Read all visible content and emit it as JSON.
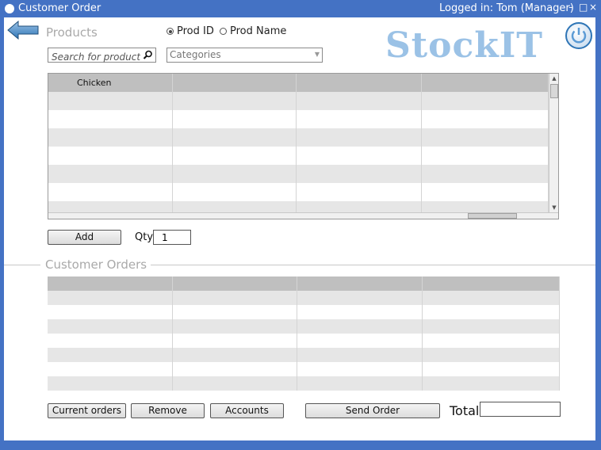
{
  "window": {
    "title": "Customer Order",
    "login_status": "Logged in: Tom (Manager)",
    "minimize_glyph": "–",
    "maximize_glyph": "□",
    "close_glyph": "×"
  },
  "products": {
    "section_label": "Products",
    "search_mode": {
      "options": [
        "Prod ID",
        "Prod Name"
      ],
      "selected": "Prod ID"
    },
    "search": {
      "placeholder": "Search for product",
      "value": ""
    },
    "category": {
      "selected": "Categories"
    },
    "table": {
      "columns": [
        "Chicken",
        "",
        "",
        ""
      ],
      "rows": [
        [
          "",
          "",
          "",
          ""
        ],
        [
          "",
          "",
          "",
          ""
        ],
        [
          "",
          "",
          "",
          ""
        ],
        [
          "",
          "",
          "",
          ""
        ],
        [
          "",
          "",
          "",
          ""
        ],
        [
          "",
          "",
          "",
          ""
        ],
        [
          "",
          "",
          "",
          ""
        ]
      ]
    },
    "add_label": "Add",
    "qty_label": "Qty",
    "qty_value": "1"
  },
  "brand": {
    "logo_text": "StockIT",
    "logo_color": "#9bc2e6"
  },
  "orders": {
    "section_label": "Customer Orders",
    "table": {
      "columns": [
        "",
        "",
        "",
        ""
      ],
      "rows": [
        [
          "",
          "",
          "",
          ""
        ],
        [
          "",
          "",
          "",
          ""
        ],
        [
          "",
          "",
          "",
          ""
        ],
        [
          "",
          "",
          "",
          ""
        ],
        [
          "",
          "",
          "",
          ""
        ],
        [
          "",
          "",
          "",
          ""
        ],
        [
          "",
          "",
          "",
          ""
        ]
      ]
    },
    "buttons": {
      "current_orders": "Current orders",
      "remove": "Remove",
      "accounts": "Accounts",
      "send_order": "Send Order"
    },
    "total_label": "Total",
    "total_value": ""
  },
  "colors": {
    "window_frame": "#4472c4",
    "header_row": "#bfbfbf",
    "alt_row": "#e6e6e6",
    "section_label": "#a9a9a9",
    "back_arrow": "#5b9bd5"
  },
  "icons": {
    "back": "back-arrow-icon",
    "search": "search-icon",
    "power": "power-icon",
    "dropdown": "chevron-down-icon"
  }
}
